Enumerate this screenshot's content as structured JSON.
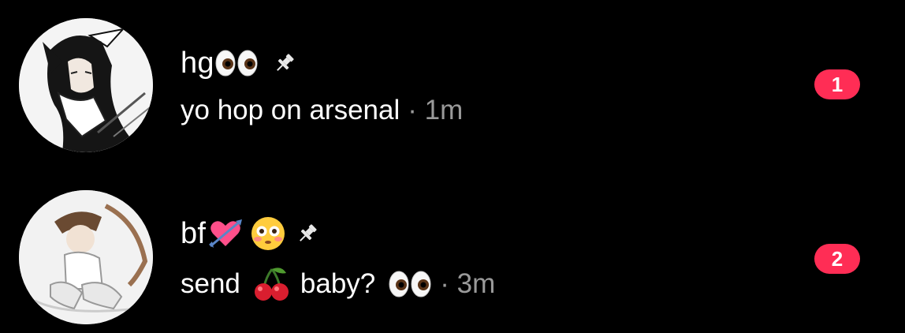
{
  "conversations": [
    {
      "name": "hg",
      "name_emoji": "eyes-emoji",
      "pinned": true,
      "preview": "yo hop on arsenal",
      "separator": "·",
      "time": "1m",
      "unread_count": "1",
      "avatar": "anime-character-avatar"
    },
    {
      "name": "bf",
      "name_emoji": [
        "heart-with-arrow-emoji",
        "flushed-face-emoji"
      ],
      "pinned": true,
      "preview_before": "send",
      "preview_emoji_1": "cherries-emoji",
      "preview_after": "baby?",
      "preview_emoji_2": "eyes-emoji",
      "separator": "·",
      "time": "3m",
      "unread_count": "2",
      "avatar": "anime-character-avatar"
    }
  ],
  "colors": {
    "background": "#000000",
    "text": "#ffffff",
    "meta": "#9a9a9a",
    "badge": "#ff2d55"
  }
}
